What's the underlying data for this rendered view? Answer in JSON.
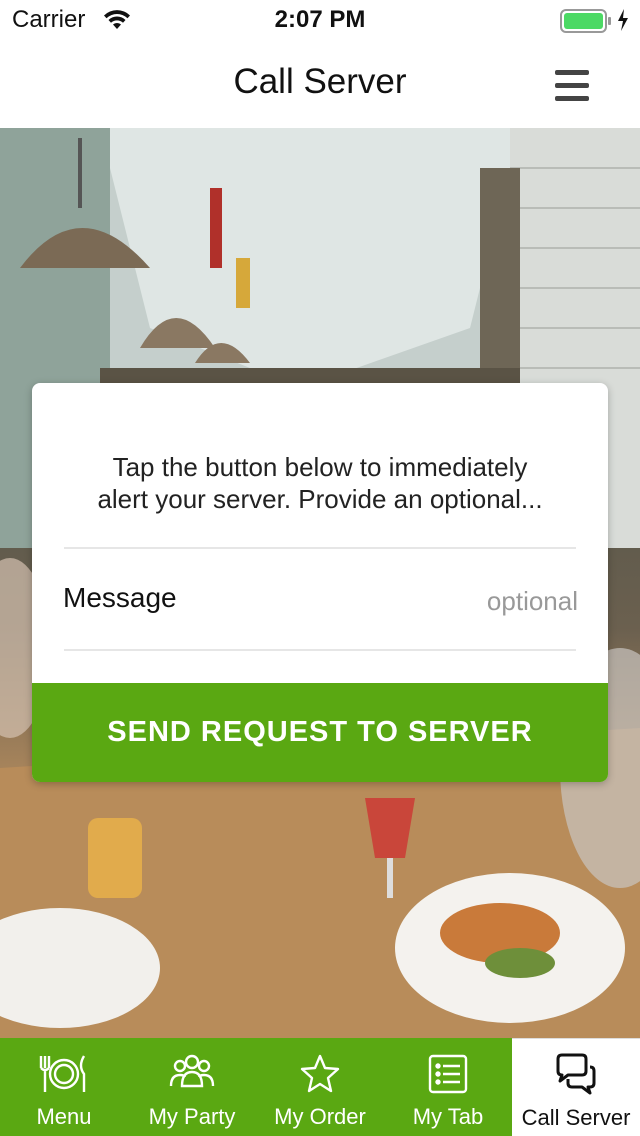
{
  "status_bar": {
    "carrier": "Carrier",
    "time": "2:07 PM",
    "battery_color": "#4cd964"
  },
  "nav": {
    "title": "Call Server",
    "menu_icon": "hamburger-icon"
  },
  "card": {
    "instruction_line1": "Tap the button below to immediately",
    "instruction_line2": "alert your server. Provide an optional...",
    "message_label": "Message",
    "message_placeholder": "optional",
    "message_value": "",
    "send_button_label": "SEND REQUEST TO SERVER"
  },
  "tabs": [
    {
      "label": "Menu",
      "icon": "plate-cutlery-icon",
      "active": false
    },
    {
      "label": "My Party",
      "icon": "group-icon",
      "active": false
    },
    {
      "label": "My Order",
      "icon": "star-icon",
      "active": false
    },
    {
      "label": "My Tab",
      "icon": "receipt-list-icon",
      "active": false
    },
    {
      "label": "Call Server",
      "icon": "chat-bubbles-icon",
      "active": true
    }
  ],
  "colors": {
    "accent_green": "#5aa812",
    "tab_active_bg": "#ffffff"
  }
}
